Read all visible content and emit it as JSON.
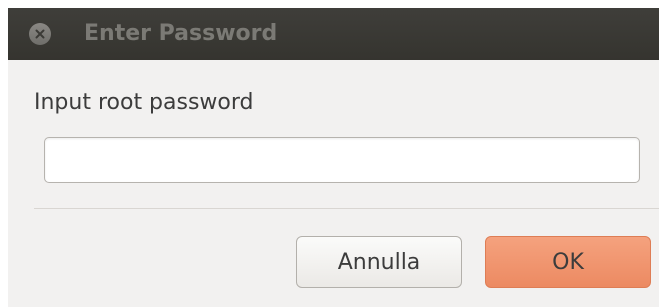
{
  "window": {
    "title": "Enter Password"
  },
  "dialog": {
    "prompt": "Input root password",
    "password_value": "",
    "cancel_label": "Annulla",
    "ok_label": "OK"
  },
  "icons": {
    "close": "close-icon"
  },
  "colors": {
    "titlebar": "#3a3935",
    "title_text": "#7b7a75",
    "dialog_bg": "#f2f1f0",
    "ok_button": "#f09570",
    "cancel_button": "#f4f3f1"
  }
}
